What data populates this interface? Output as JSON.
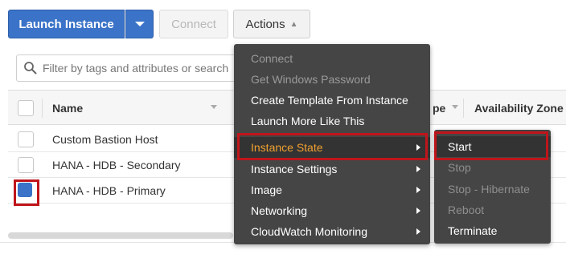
{
  "toolbar": {
    "launch_label": "Launch Instance",
    "connect_label": "Connect",
    "actions_label": "Actions"
  },
  "search": {
    "placeholder": "Filter by tags and attributes or search"
  },
  "table": {
    "headers": [
      "Name",
      "pe",
      "Availability Zone"
    ],
    "rows": [
      {
        "name": "Custom Bastion Host",
        "selected": false
      },
      {
        "name": "HANA - HDB - Secondary",
        "selected": false
      },
      {
        "name": "HANA - HDB - Primary",
        "selected": true
      }
    ]
  },
  "menu": {
    "items": [
      {
        "label": "Connect",
        "disabled": true
      },
      {
        "label": "Get Windows Password",
        "disabled": true
      },
      {
        "label": "Create Template From Instance",
        "disabled": false
      },
      {
        "label": "Launch More Like This",
        "disabled": false
      },
      {
        "label": "Instance State",
        "disabled": false,
        "submenu": true,
        "active": true
      },
      {
        "label": "Instance Settings",
        "disabled": false,
        "submenu": true
      },
      {
        "label": "Image",
        "disabled": false,
        "submenu": true
      },
      {
        "label": "Networking",
        "disabled": false,
        "submenu": true
      },
      {
        "label": "CloudWatch Monitoring",
        "disabled": false,
        "submenu": true
      }
    ]
  },
  "submenu": {
    "items": [
      {
        "label": "Start",
        "disabled": false,
        "active": true
      },
      {
        "label": "Stop",
        "disabled": true
      },
      {
        "label": "Stop - Hibernate",
        "disabled": true
      },
      {
        "label": "Reboot",
        "disabled": true
      },
      {
        "label": "Terminate",
        "disabled": false
      }
    ]
  },
  "colors": {
    "primary": "#3a73c8",
    "highlight": "#c0151b",
    "menu_bg": "#454545",
    "menu_active_text": "#f0a030"
  }
}
